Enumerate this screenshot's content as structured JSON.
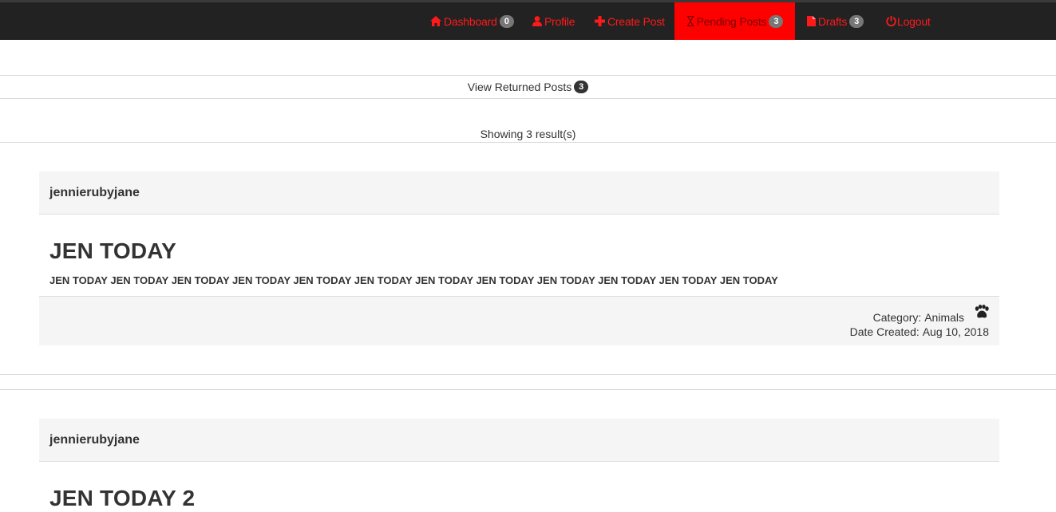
{
  "nav": {
    "items": [
      {
        "label": "Dashboard",
        "badge": "0",
        "icon": "home-icon"
      },
      {
        "label": "Profile",
        "icon": "user-icon"
      },
      {
        "label": "Create Post",
        "icon": "plus-icon"
      },
      {
        "label": "Pending Posts",
        "badge": "3",
        "icon": "hourglass-icon",
        "active": true
      },
      {
        "label": "Drafts",
        "badge": "3",
        "icon": "file-icon"
      },
      {
        "label": "Logout",
        "icon": "power-icon"
      }
    ],
    "colors": {
      "bar": "#222222",
      "link": "#ff1a1a",
      "active_bg": "#ff0000"
    }
  },
  "returned": {
    "label": "View Returned Posts",
    "count": "3"
  },
  "results": {
    "text": "Showing 3 result(s)"
  },
  "posts": [
    {
      "author": "jennierubyjane",
      "title": "JEN TODAY",
      "content": "JEN TODAY JEN TODAY JEN TODAY JEN TODAY JEN TODAY JEN TODAY JEN TODAY JEN TODAY JEN TODAY JEN TODAY JEN TODAY JEN TODAY",
      "category_label": "Category:",
      "category": "Animals",
      "category_icon": "paw-icon",
      "date_label": "Date Created:",
      "date": "Aug 10, 2018"
    },
    {
      "author": "jennierubyjane",
      "title": "JEN TODAY 2"
    }
  ]
}
